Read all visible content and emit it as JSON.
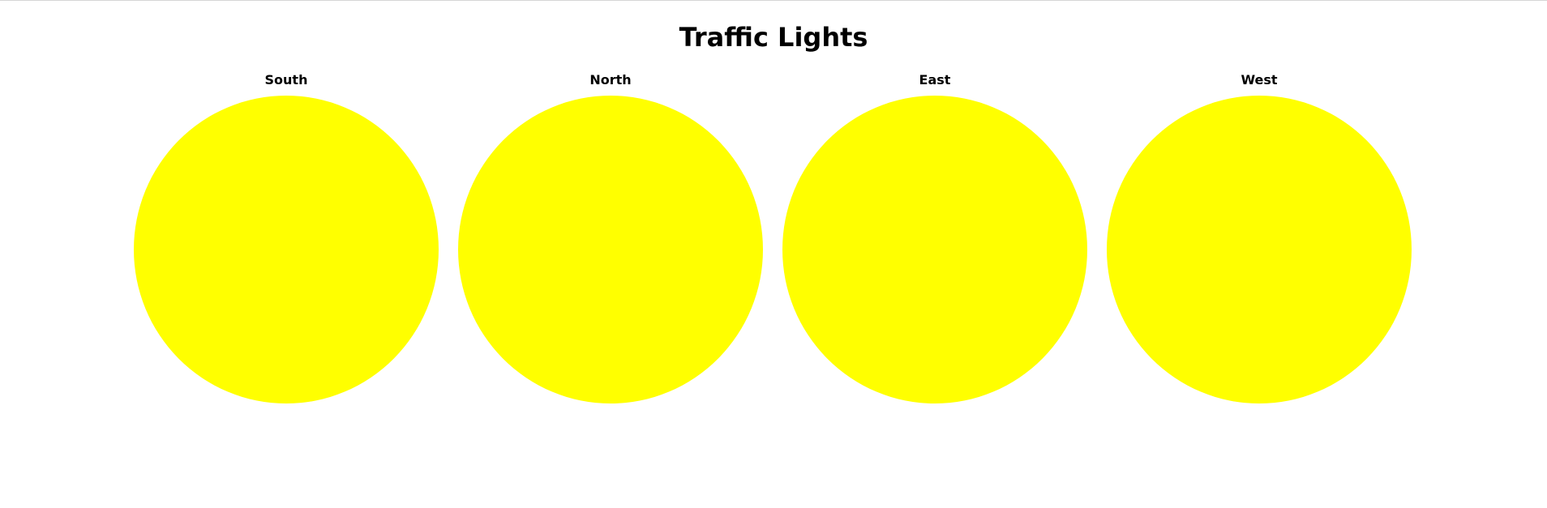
{
  "title": "Traffic Lights",
  "lights": [
    {
      "label": "South",
      "color": "#ffff00"
    },
    {
      "label": "North",
      "color": "#ffff00"
    },
    {
      "label": "East",
      "color": "#ffff00"
    },
    {
      "label": "West",
      "color": "#ffff00"
    }
  ]
}
